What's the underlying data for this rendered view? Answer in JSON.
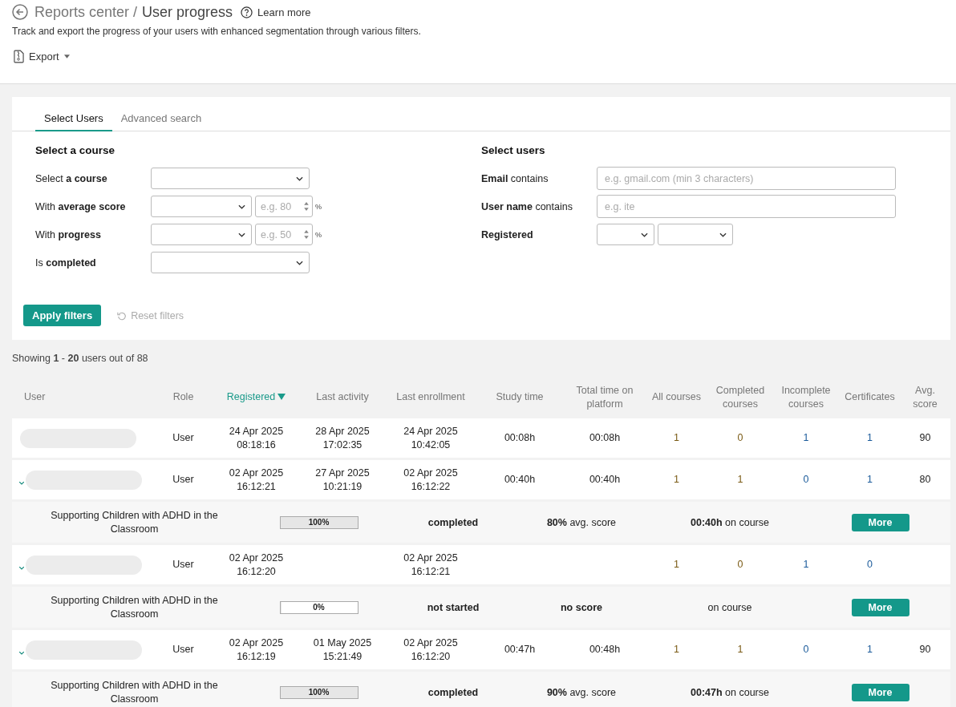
{
  "header": {
    "breadcrumb_parent": "Reports center /",
    "title": "User progress",
    "help_link": "Learn more",
    "description": "Track and export the progress of your users with enhanced segmentation through various filters.",
    "export_button": "Export"
  },
  "tabs": [
    {
      "label": "Select Users",
      "selected": true
    },
    {
      "label": "Advanced search",
      "selected": false
    }
  ],
  "course_filters": {
    "heading": "Select a course",
    "fields": [
      {
        "label": "Select **a course**",
        "kind": "select"
      },
      {
        "label": "With **average score**",
        "kind": "select-number",
        "placeholder": "e.g. 80",
        "unit": "%"
      },
      {
        "label": "With **progress**",
        "kind": "select-number",
        "placeholder": "e.g. 50",
        "unit": "%"
      },
      {
        "label": "Is **completed**",
        "kind": "select"
      }
    ]
  },
  "user_filters": {
    "heading": "Select users",
    "fields": [
      {
        "label": "**Email** contains",
        "kind": "text",
        "placeholder": "e.g. gmail.com (min 3 characters)"
      },
      {
        "label": "**User name** contains",
        "kind": "text",
        "placeholder": "e.g. ite"
      },
      {
        "label": "**Registered**",
        "kind": "two-selects"
      }
    ]
  },
  "apply_button": "Apply filters",
  "reset_button": {
    "label": "Reset filters",
    "disabled": true
  },
  "showing": "Showing **1** - **20** users out of 88",
  "table": {
    "columns": [
      {
        "label": "User",
        "sorted": false
      },
      {
        "label": "Role",
        "sorted": false
      },
      {
        "label": "Registered",
        "sorted": true
      },
      {
        "label": "Last activity",
        "sorted": false
      },
      {
        "label": "Last enrollment",
        "sorted": false
      },
      {
        "label": "Study time",
        "sorted": false
      },
      {
        "label": "Total time on platform",
        "sorted": false
      },
      {
        "label": "All courses",
        "sorted": false
      },
      {
        "label": "Completed courses",
        "sorted": false
      },
      {
        "label": "Incomplete courses",
        "sorted": false
      },
      {
        "label": "Certificates",
        "sorted": false
      },
      {
        "label": "Avg. score",
        "sorted": false
      }
    ],
    "rows": [
      {
        "expanded": false,
        "role": "User",
        "registered": [
          "24 Apr 2025",
          "08:18:16"
        ],
        "last_activity": [
          "28 Apr 2025",
          "17:02:35"
        ],
        "last_enrollment": [
          "24 Apr 2025",
          "10:42:05"
        ],
        "study_time": "00:08h",
        "total_time": "00:08h",
        "all": "1",
        "completed": "0",
        "incomplete": "1",
        "certificates": "1",
        "avg_score": "90"
      },
      {
        "expanded": true,
        "role": "User",
        "registered": [
          "02 Apr 2025",
          "16:12:21"
        ],
        "last_activity": [
          "27 Apr 2025",
          "10:21:19"
        ],
        "last_enrollment": [
          "02 Apr 2025",
          "16:12:22"
        ],
        "study_time": "00:40h",
        "total_time": "00:40h",
        "all": "1",
        "completed": "1",
        "incomplete": "0",
        "certificates": "1",
        "avg_score": "80",
        "detail": {
          "course": "Supporting Children with ADHD in the Classroom",
          "level": 1,
          "progress": "100%",
          "status": "completed",
          "score": "**80%** avg. score",
          "time": "**00:40h** on course",
          "button": "More"
        }
      },
      {
        "expanded": true,
        "role": "User",
        "registered": [
          "02 Apr 2025",
          "16:12:20"
        ],
        "last_enrollment": [
          "02 Apr 2025",
          "16:12:21"
        ],
        "all": "1",
        "completed": "0",
        "incomplete": "1",
        "certificates": "0",
        "detail": {
          "course": "Supporting Children with ADHD in the Classroom",
          "level": 0,
          "progress": "0%",
          "status": "not started",
          "score": "**no score**",
          "time": "on course",
          "button": "More"
        }
      },
      {
        "expanded": true,
        "role": "User",
        "registered": [
          "02 Apr 2025",
          "16:12:19"
        ],
        "last_activity": [
          "01 May 2025",
          "15:21:49"
        ],
        "last_enrollment": [
          "02 Apr 2025",
          "16:12:20"
        ],
        "study_time": "00:47h",
        "total_time": "00:48h",
        "all": "1",
        "completed": "1",
        "incomplete": "0",
        "certificates": "1",
        "avg_score": "90",
        "detail": {
          "course": "Supporting Children with ADHD in the Classroom",
          "level": 1,
          "progress": "100%",
          "status": "completed",
          "score": "**90%** avg. score",
          "time": "**00:47h** on course",
          "button": "More"
        }
      }
    ]
  }
}
